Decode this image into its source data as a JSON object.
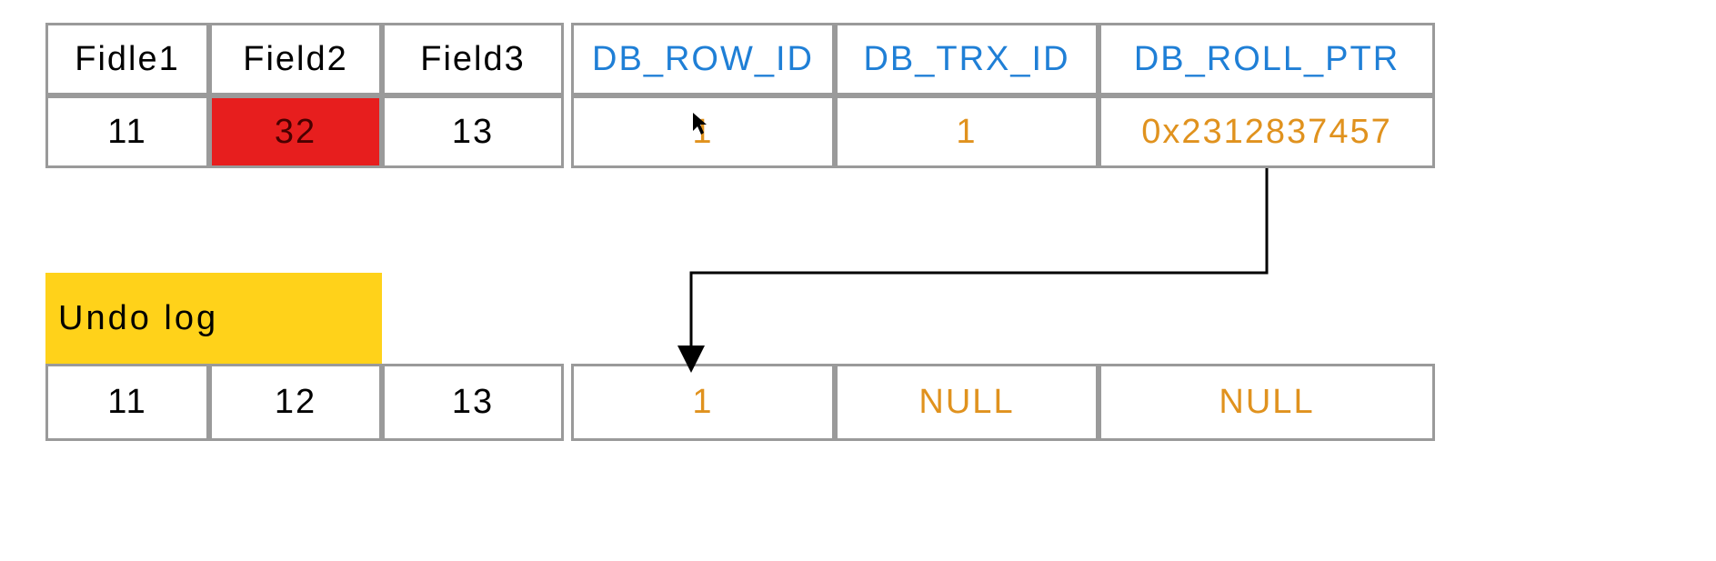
{
  "colors": {
    "border": "#9a9a9a",
    "header_blue": "#1f7fd6",
    "value_orange": "#e0921e",
    "highlight_red": "#e71e1e",
    "undo_yellow": "#ffd21a"
  },
  "top_table": {
    "headers": {
      "f1": "Fidle1",
      "f2": "Field2",
      "f3": "Field3",
      "row_id": "DB_ROW_ID",
      "trx_id": "DB_TRX_ID",
      "roll_ptr": "DB_ROLL_PTR"
    },
    "row": {
      "f1": "11",
      "f2": "32",
      "f3": "13",
      "row_id": "1",
      "trx_id": "1",
      "roll_ptr": "0x2312837457"
    }
  },
  "undo": {
    "label": "Undo log",
    "row": {
      "f1": "11",
      "f2": "12",
      "f3": "13",
      "row_id": "1",
      "trx_id": "NULL",
      "roll_ptr": "NULL"
    }
  }
}
